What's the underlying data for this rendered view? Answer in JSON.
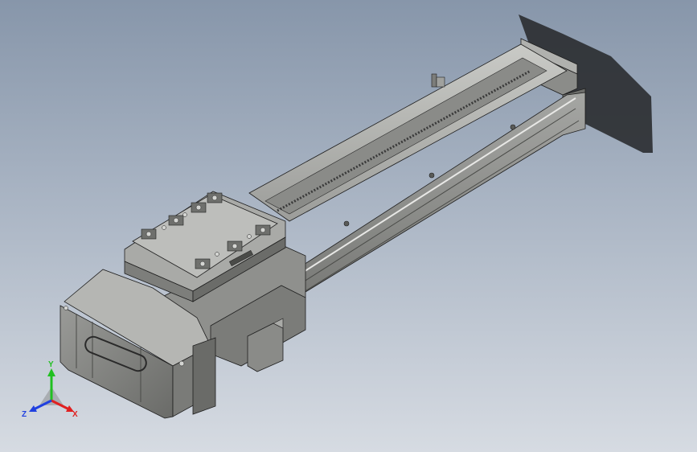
{
  "viewport": {
    "background_top": "#8796aa",
    "background_bottom": "#d6dbe2"
  },
  "model": {
    "body_color": "#8e8f8d",
    "body_light": "#b6b7b4",
    "body_dark": "#5f605e",
    "outline": "#1e1e1e",
    "shadow_color": "#2a2c30"
  },
  "triad": {
    "x_label": "X",
    "y_label": "Y",
    "z_label": "Z",
    "x_color": "#e02020",
    "y_color": "#20c020",
    "z_color": "#2040e0"
  }
}
